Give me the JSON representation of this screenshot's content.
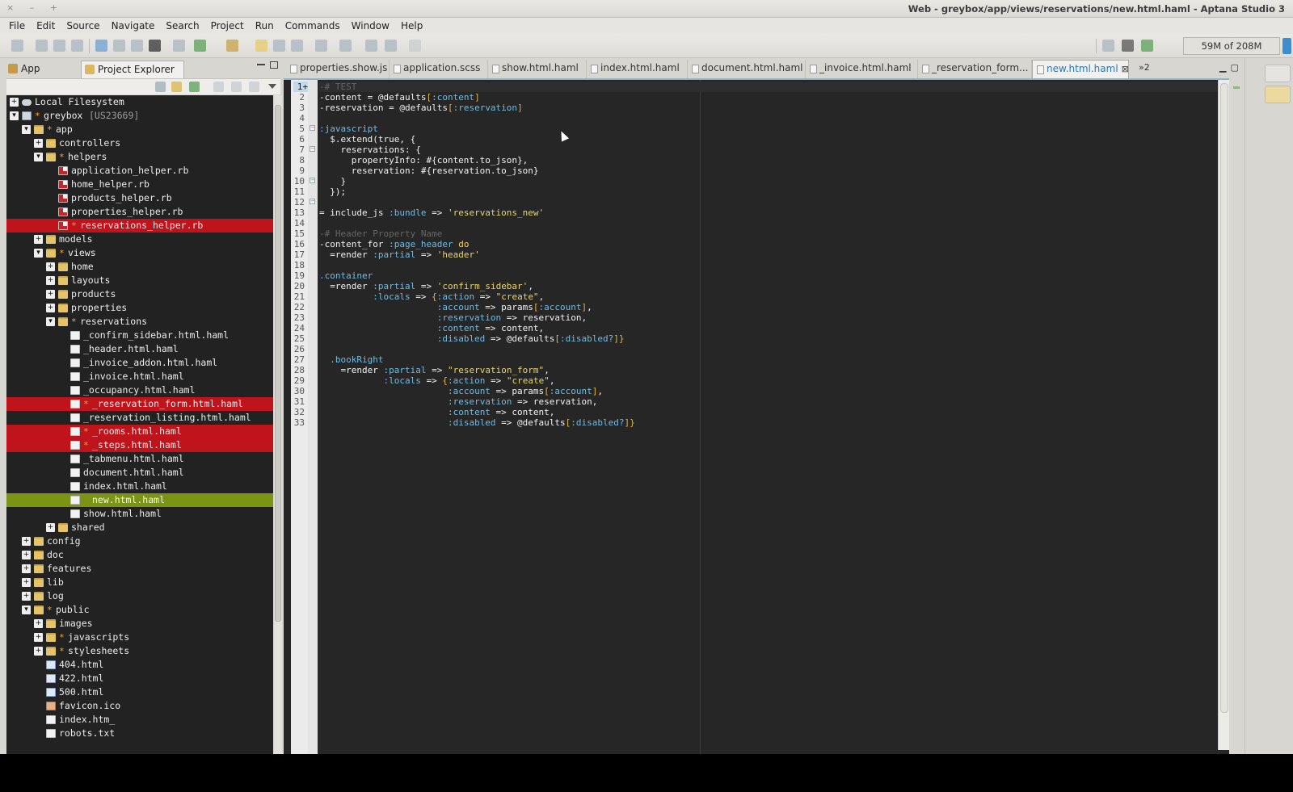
{
  "window": {
    "title": "Web - greybox/app/views/reservations/new.html.haml - Aptana Studio 3",
    "controls": "× – +"
  },
  "menu": [
    "File",
    "Edit",
    "Source",
    "Navigate",
    "Search",
    "Project",
    "Run",
    "Commands",
    "Window",
    "Help"
  ],
  "toolbar": {
    "memory": "59M of 208M"
  },
  "left_panel": {
    "tabs": [
      {
        "label": "App Explorer",
        "icon": "app-explorer-icon",
        "active": false
      },
      {
        "label": "Project Explorer",
        "icon": "project-explorer-icon",
        "active": true,
        "close": "⊠"
      }
    ],
    "tree": [
      {
        "label": "Local Filesystem",
        "depth": 0,
        "twisty": "+",
        "icon": "drive-icon"
      },
      {
        "label": "greybox",
        "tag": "[US23669]",
        "depth": 0,
        "twisty": "▾",
        "icon": "project-icon",
        "dirty": true
      },
      {
        "label": "app",
        "depth": 1,
        "twisty": "▾",
        "icon": "folder-icon",
        "dirty": true
      },
      {
        "label": "controllers",
        "depth": 2,
        "twisty": "+",
        "icon": "folder-icon"
      },
      {
        "label": "helpers",
        "depth": 2,
        "twisty": "▾",
        "icon": "folder-icon",
        "dirty": true
      },
      {
        "label": "application_helper.rb",
        "depth": 3,
        "icon": "ruby-file-icon"
      },
      {
        "label": "home_helper.rb",
        "depth": 3,
        "icon": "ruby-file-icon"
      },
      {
        "label": "products_helper.rb",
        "depth": 3,
        "icon": "ruby-file-icon"
      },
      {
        "label": "properties_helper.rb",
        "depth": 3,
        "icon": "ruby-file-icon"
      },
      {
        "label": "reservations_helper.rb",
        "depth": 3,
        "icon": "ruby-file-icon",
        "dirty": true,
        "highlight": "red"
      },
      {
        "label": "models",
        "depth": 2,
        "twisty": "+",
        "icon": "folder-icon"
      },
      {
        "label": "views",
        "depth": 2,
        "twisty": "▾",
        "icon": "folder-icon",
        "dirty": true
      },
      {
        "label": "home",
        "depth": 3,
        "twisty": "+",
        "icon": "folder-icon"
      },
      {
        "label": "layouts",
        "depth": 3,
        "twisty": "+",
        "icon": "folder-icon"
      },
      {
        "label": "products",
        "depth": 3,
        "twisty": "+",
        "icon": "folder-icon"
      },
      {
        "label": "properties",
        "depth": 3,
        "twisty": "+",
        "icon": "folder-icon"
      },
      {
        "label": "reservations",
        "depth": 3,
        "twisty": "▾",
        "icon": "folder-icon",
        "dirty": true
      },
      {
        "label": "_confirm_sidebar.html.haml",
        "depth": 4,
        "icon": "file-icon"
      },
      {
        "label": "_header.html.haml",
        "depth": 4,
        "icon": "file-icon"
      },
      {
        "label": "_invoice_addon.html.haml",
        "depth": 4,
        "icon": "file-icon"
      },
      {
        "label": "_invoice.html.haml",
        "depth": 4,
        "icon": "file-icon"
      },
      {
        "label": "_occupancy.html.haml",
        "depth": 4,
        "icon": "file-icon"
      },
      {
        "label": "_reservation_form.html.haml",
        "depth": 4,
        "icon": "file-icon",
        "dirty": true,
        "highlight": "red"
      },
      {
        "label": "_reservation_listing.html.haml",
        "depth": 4,
        "icon": "file-icon"
      },
      {
        "label": "_rooms.html.haml",
        "depth": 4,
        "icon": "file-icon",
        "dirty": true,
        "highlight": "red"
      },
      {
        "label": "_steps.html.haml",
        "depth": 4,
        "icon": "file-icon",
        "dirty": true,
        "highlight": "red"
      },
      {
        "label": "_tabmenu.html.haml",
        "depth": 4,
        "icon": "file-icon"
      },
      {
        "label": "document.html.haml",
        "depth": 4,
        "icon": "file-icon"
      },
      {
        "label": "index.html.haml",
        "depth": 4,
        "icon": "file-icon"
      },
      {
        "label": "new.html.haml",
        "depth": 4,
        "icon": "file-icon",
        "highlight": "green",
        "indent_label": true
      },
      {
        "label": "show.html.haml",
        "depth": 4,
        "icon": "file-icon"
      },
      {
        "label": "shared",
        "depth": 3,
        "twisty": "+",
        "icon": "folder-icon"
      },
      {
        "label": "config",
        "depth": 1,
        "twisty": "+",
        "icon": "folder-icon"
      },
      {
        "label": "doc",
        "depth": 1,
        "twisty": "+",
        "icon": "folder-icon"
      },
      {
        "label": "features",
        "depth": 1,
        "twisty": "+",
        "icon": "folder-icon"
      },
      {
        "label": "lib",
        "depth": 1,
        "twisty": "+",
        "icon": "folder-icon"
      },
      {
        "label": "log",
        "depth": 1,
        "twisty": "+",
        "icon": "folder-icon"
      },
      {
        "label": "public",
        "depth": 1,
        "twisty": "▾",
        "icon": "folder-icon",
        "dirty": true
      },
      {
        "label": "images",
        "depth": 2,
        "twisty": "+",
        "icon": "folder-icon"
      },
      {
        "label": "javascripts",
        "depth": 2,
        "twisty": "+",
        "icon": "folder-icon",
        "dirty": true
      },
      {
        "label": "stylesheets",
        "depth": 2,
        "twisty": "+",
        "icon": "folder-icon",
        "dirty": true
      },
      {
        "label": "404.html",
        "depth": 2,
        "icon": "html-file-icon"
      },
      {
        "label": "422.html",
        "depth": 2,
        "icon": "html-file-icon"
      },
      {
        "label": "500.html",
        "depth": 2,
        "icon": "html-file-icon"
      },
      {
        "label": "favicon.ico",
        "depth": 2,
        "icon": "ico-file-icon"
      },
      {
        "label": "index.htm_",
        "depth": 2,
        "icon": "file-icon"
      },
      {
        "label": "robots.txt",
        "depth": 2,
        "icon": "file-icon"
      }
    ]
  },
  "editor": {
    "tabs": [
      {
        "label": "properties.show.js",
        "active": false
      },
      {
        "label": "application.scss",
        "active": false
      },
      {
        "label": "show.html.haml",
        "active": false
      },
      {
        "label": "index.html.haml",
        "active": false
      },
      {
        "label": "document.html.haml",
        "active": false
      },
      {
        "label": "_invoice.html.haml",
        "active": false
      },
      {
        "label": "_reservation_form...",
        "active": false
      },
      {
        "label": "new.html.haml",
        "active": true,
        "close": "⊠"
      }
    ],
    "overflow": "»2",
    "current_line": 1,
    "lines": [
      [
        [
          "t-com",
          "-# TEST"
        ]
      ],
      [
        [
          "t-op",
          "-content = @defaults"
        ],
        [
          "t-brk",
          "["
        ],
        [
          "t-sym",
          ":content"
        ],
        [
          "t-brk",
          "]"
        ]
      ],
      [
        [
          "t-op",
          "-reservation = @defaults"
        ],
        [
          "t-brk",
          "["
        ],
        [
          "t-sym",
          ":reservation"
        ],
        [
          "t-brk",
          "]"
        ]
      ],
      [],
      [
        [
          "t-filter",
          ":javascript"
        ]
      ],
      [
        [
          "t-op",
          "  $.extend(true, {"
        ]
      ],
      [
        [
          "t-op",
          "    reservations: {"
        ]
      ],
      [
        [
          "t-op",
          "      propertyInfo: #{content.to_json},"
        ]
      ],
      [
        [
          "t-op",
          "      reservation: #{reservation.to_json}"
        ]
      ],
      [
        [
          "t-op",
          "    }"
        ]
      ],
      [
        [
          "t-op",
          "  });"
        ]
      ],
      [],
      [
        [
          "t-op",
          "= include_js "
        ],
        [
          "t-sym",
          ":bundle"
        ],
        [
          "t-op",
          " => "
        ],
        [
          "t-str",
          "'reservations_new'"
        ]
      ],
      [],
      [
        [
          "t-com",
          "-# Header Property Name"
        ]
      ],
      [
        [
          "t-op",
          "-content_for "
        ],
        [
          "t-sym",
          ":page_header"
        ],
        [
          "t-kw",
          " do"
        ]
      ],
      [
        [
          "t-op",
          "  =render "
        ],
        [
          "t-sym",
          ":partial"
        ],
        [
          "t-op",
          " => "
        ],
        [
          "t-str",
          "'header'"
        ]
      ],
      [],
      [
        [
          "t-cls",
          ".container"
        ]
      ],
      [
        [
          "t-op",
          "  =render "
        ],
        [
          "t-sym",
          ":partial"
        ],
        [
          "t-op",
          " => "
        ],
        [
          "t-str",
          "'confirm_sidebar'"
        ],
        [
          "t-op",
          ","
        ]
      ],
      [
        [
          "t-op",
          "          "
        ],
        [
          "t-sym",
          ":locals"
        ],
        [
          "t-op",
          " => "
        ],
        [
          "t-brk",
          "{"
        ],
        [
          "t-sym",
          ":action"
        ],
        [
          "t-op",
          " => "
        ],
        [
          "t-str",
          "\"create\""
        ],
        [
          "t-op",
          ","
        ]
      ],
      [
        [
          "t-op",
          "                      "
        ],
        [
          "t-sym",
          ":account"
        ],
        [
          "t-op",
          " => params"
        ],
        [
          "t-brk",
          "["
        ],
        [
          "t-sym",
          ":account"
        ],
        [
          "t-brk",
          "]"
        ],
        [
          "t-op",
          ","
        ]
      ],
      [
        [
          "t-op",
          "                      "
        ],
        [
          "t-sym",
          ":reservation"
        ],
        [
          "t-op",
          " => reservation,"
        ]
      ],
      [
        [
          "t-op",
          "                      "
        ],
        [
          "t-sym",
          ":content"
        ],
        [
          "t-op",
          " => content,"
        ]
      ],
      [
        [
          "t-op",
          "                      "
        ],
        [
          "t-sym",
          ":disabled"
        ],
        [
          "t-op",
          " => @defaults"
        ],
        [
          "t-brk",
          "["
        ],
        [
          "t-sym",
          ":disabled?"
        ],
        [
          "t-brk",
          "]}"
        ]
      ],
      [],
      [
        [
          "t-cls",
          "  .bookRight"
        ]
      ],
      [
        [
          "t-op",
          "    =render "
        ],
        [
          "t-sym",
          ":partial"
        ],
        [
          "t-op",
          " => "
        ],
        [
          "t-str",
          "\"reservation_form\""
        ],
        [
          "t-op",
          ","
        ]
      ],
      [
        [
          "t-op",
          "            "
        ],
        [
          "t-sym",
          ":locals"
        ],
        [
          "t-op",
          " => "
        ],
        [
          "t-brk",
          "{"
        ],
        [
          "t-sym",
          ":action"
        ],
        [
          "t-op",
          " => "
        ],
        [
          "t-str",
          "\"create\""
        ],
        [
          "t-op",
          ","
        ]
      ],
      [
        [
          "t-op",
          "                        "
        ],
        [
          "t-sym",
          ":account"
        ],
        [
          "t-op",
          " => params"
        ],
        [
          "t-brk",
          "["
        ],
        [
          "t-sym",
          ":account"
        ],
        [
          "t-brk",
          "]"
        ],
        [
          "t-op",
          ","
        ]
      ],
      [
        [
          "t-op",
          "                        "
        ],
        [
          "t-sym",
          ":reservation"
        ],
        [
          "t-op",
          " => reservation,"
        ]
      ],
      [
        [
          "t-op",
          "                        "
        ],
        [
          "t-sym",
          ":content"
        ],
        [
          "t-op",
          " => content,"
        ]
      ],
      [
        [
          "t-op",
          "                        "
        ],
        [
          "t-sym",
          ":disabled"
        ],
        [
          "t-op",
          " => @defaults"
        ],
        [
          "t-brk",
          "["
        ],
        [
          "t-sym",
          ":disabled?"
        ],
        [
          "t-brk",
          "]}"
        ]
      ]
    ],
    "fold_markers": [
      5,
      7,
      10,
      12
    ]
  }
}
